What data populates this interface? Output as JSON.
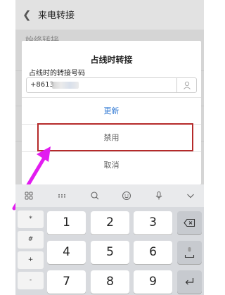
{
  "header": {
    "title": "来电转接"
  },
  "background": {
    "row_partial": "始终转接"
  },
  "dialog": {
    "title": "占线时转接",
    "field_label": "占线时的转接号码",
    "field_value": "+8613",
    "option_update": "更新",
    "option_disable": "禁用",
    "option_cancel": "取消"
  },
  "keyboard": {
    "side_keys": [
      "*",
      "#",
      "+",
      "-"
    ],
    "digits": [
      "1",
      "2",
      "3",
      "4",
      "5",
      "6",
      "7",
      "8",
      "9"
    ]
  },
  "colors": {
    "accent_blue": "#3a7fd5",
    "highlight_red": "#b52a2a",
    "arrow_magenta": "#e21cf0"
  }
}
